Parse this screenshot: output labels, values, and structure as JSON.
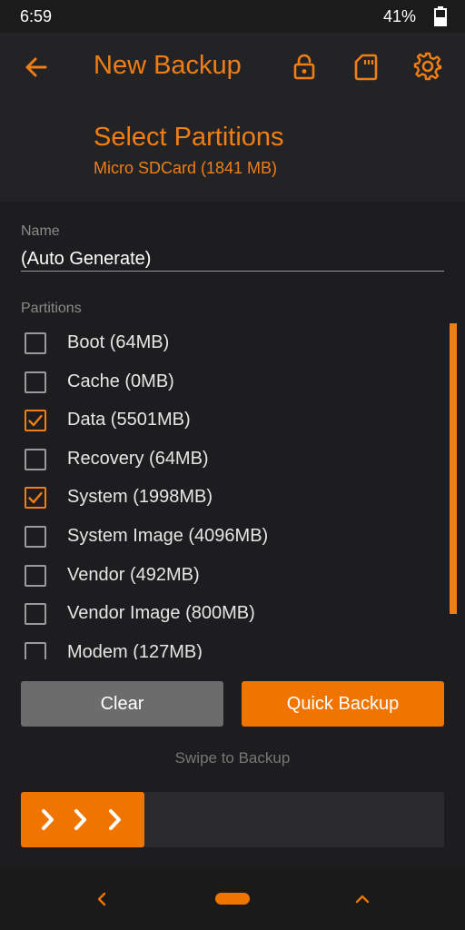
{
  "status_bar": {
    "time": "6:59",
    "battery": "41%"
  },
  "header": {
    "app_title": "New Backup",
    "screen_title": "Select Partitions",
    "storage_label": "Micro SDCard (1841 MB)",
    "icons": [
      "back-arrow-icon",
      "lock-icon",
      "sd-card-icon",
      "gear-icon"
    ]
  },
  "form": {
    "name_label": "Name",
    "name_value": "(Auto Generate)",
    "partitions_label": "Partitions"
  },
  "partitions": [
    {
      "label": "Boot (64MB)",
      "checked": false
    },
    {
      "label": "Cache (0MB)",
      "checked": false
    },
    {
      "label": "Data (5501MB)",
      "checked": true
    },
    {
      "label": "Recovery (64MB)",
      "checked": false
    },
    {
      "label": "System (1998MB)",
      "checked": true
    },
    {
      "label": "System Image (4096MB)",
      "checked": false
    },
    {
      "label": "Vendor (492MB)",
      "checked": false
    },
    {
      "label": "Vendor Image (800MB)",
      "checked": false
    },
    {
      "label": "Modem (127MB)",
      "checked": false
    }
  ],
  "buttons": {
    "clear": "Clear",
    "quick_backup": "Quick Backup"
  },
  "swipe": {
    "label": "Swipe to Backup"
  },
  "colors": {
    "accent": "#f07e14",
    "background": "#1d1d1f",
    "header": "#232325",
    "clear_button": "#6c6c6c"
  }
}
